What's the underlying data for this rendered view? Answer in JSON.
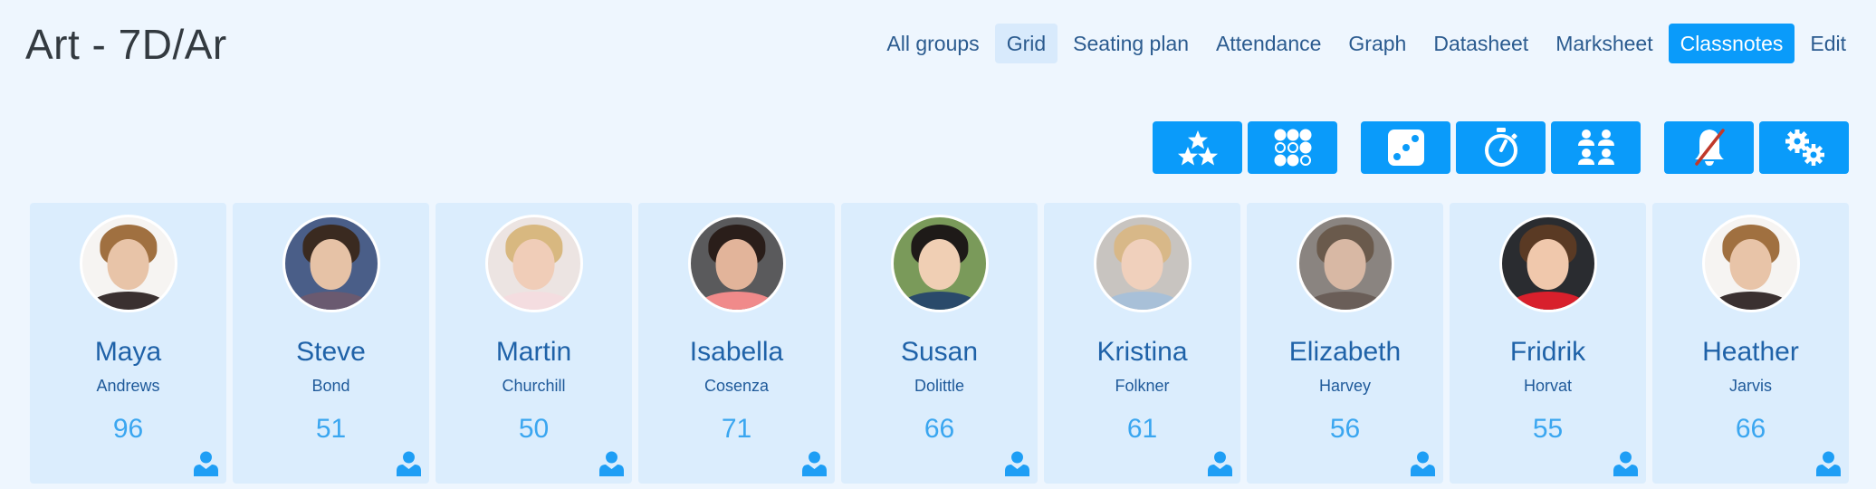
{
  "header": {
    "title": "Art - 7D/Ar"
  },
  "nav": {
    "items": [
      {
        "label": "All groups",
        "state": "normal"
      },
      {
        "label": "Grid",
        "state": "selected"
      },
      {
        "label": "Seating plan",
        "state": "normal"
      },
      {
        "label": "Attendance",
        "state": "normal"
      },
      {
        "label": "Graph",
        "state": "normal"
      },
      {
        "label": "Datasheet",
        "state": "normal"
      },
      {
        "label": "Marksheet",
        "state": "normal"
      },
      {
        "label": "Classnotes",
        "state": "primary"
      },
      {
        "label": "Edit",
        "state": "normal"
      }
    ]
  },
  "toolbar": {
    "buttons": [
      {
        "icon": "stars-icon"
      },
      {
        "icon": "dots-grid-icon"
      },
      {
        "icon": "dice-icon"
      },
      {
        "icon": "stopwatch-icon"
      },
      {
        "icon": "groups-icon"
      },
      {
        "icon": "bell-muted-icon"
      },
      {
        "icon": "gears-icon"
      }
    ]
  },
  "colors": {
    "primary": "#0a9bfa",
    "selected_nav": "#d8eafc",
    "card_bg": "#dbedfd",
    "page_bg": "#eef6fe",
    "name_color": "#1f62a8",
    "score_color": "#3aa6f0",
    "mute_slash": "#c0392b"
  },
  "students": [
    {
      "first": "Maya",
      "last": "Andrews",
      "score": "96"
    },
    {
      "first": "Steve",
      "last": "Bond",
      "score": "51"
    },
    {
      "first": "Martin",
      "last": "Churchill",
      "score": "50"
    },
    {
      "first": "Isabella",
      "last": "Cosenza",
      "score": "71"
    },
    {
      "first": "Susan",
      "last": "Dolittle",
      "score": "66"
    },
    {
      "first": "Kristina",
      "last": "Folkner",
      "score": "61"
    },
    {
      "first": "Elizabeth",
      "last": "Harvey",
      "score": "56"
    },
    {
      "first": "Fridrik",
      "last": "Horvat",
      "score": "55"
    },
    {
      "first": "Heather",
      "last": "Jarvis",
      "score": "66"
    }
  ]
}
